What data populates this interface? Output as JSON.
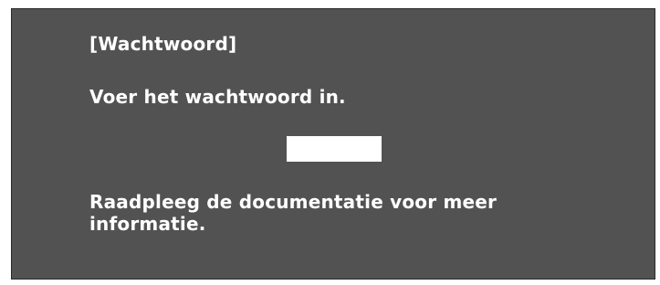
{
  "dialog": {
    "title": "[Wachtwoord]",
    "prompt": "Voer het wachtwoord in.",
    "password_value": "",
    "info_line1": "Raadpleeg de documentatie voor meer",
    "info_line2": "informatie."
  }
}
